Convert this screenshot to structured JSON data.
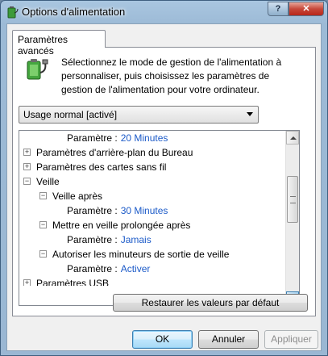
{
  "window": {
    "title": "Options d'alimentation"
  },
  "titlebar": {
    "help_label": "?",
    "close_label": "✕"
  },
  "tabs": [
    {
      "label": "Paramètres avancés"
    }
  ],
  "description": "Sélectionnez le mode de gestion de l'alimentation à personnaliser, puis choisissez les paramètres de gestion de l'alimentation pour votre ordinateur.",
  "plan_select": {
    "selected": "Usage normal [activé]"
  },
  "tree": {
    "rows": [
      {
        "label": "Paramètre :",
        "value": "20 Minutes"
      },
      {
        "label": "Paramètres d'arrière-plan du Bureau",
        "toggle": "+"
      },
      {
        "label": "Paramètres des cartes sans fil",
        "toggle": "+"
      },
      {
        "label": "Veille",
        "toggle": "−"
      },
      {
        "label": "Veille après",
        "toggle": "−"
      },
      {
        "label": "Paramètre :",
        "value": "30 Minutes"
      },
      {
        "label": "Mettre en veille prolongée après",
        "toggle": "−"
      },
      {
        "label": "Paramètre :",
        "value": "Jamais"
      },
      {
        "label": "Autoriser les minuteurs de sortie de veille",
        "toggle": "−"
      },
      {
        "label": "Paramètre :",
        "value": "Activer"
      },
      {
        "label": "Paramètres USB",
        "toggle": "+"
      }
    ]
  },
  "buttons": {
    "restore": "Restaurer les valeurs par défaut",
    "ok": "OK",
    "cancel": "Annuler",
    "apply": "Appliquer"
  },
  "icons": {
    "app": "battery-plug-icon",
    "description": "battery-power-icon",
    "help": "help-icon",
    "close": "close-icon"
  },
  "colors": {
    "link_value": "#1b5ac8",
    "close_button": "#c7483a"
  }
}
